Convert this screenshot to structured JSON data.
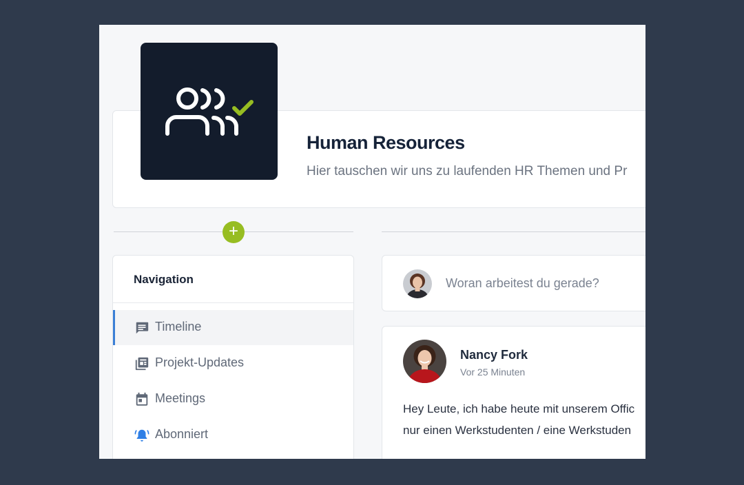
{
  "group": {
    "title": "Human Resources",
    "description": "Hier tauschen wir uns zu laufenden HR Themen und Pr",
    "logo_icon": "people-check-icon",
    "logo_bg": "#131c2c",
    "logo_accent": "#97bd22"
  },
  "add_button": {
    "label": "+",
    "icon": "plus-icon",
    "color": "#97bd22"
  },
  "navigation": {
    "title": "Navigation",
    "items": [
      {
        "label": "Timeline",
        "icon": "comment-icon",
        "active": true
      },
      {
        "label": "Projekt-Updates",
        "icon": "news-icon",
        "active": false
      },
      {
        "label": "Meetings",
        "icon": "calendar-icon",
        "active": false
      },
      {
        "label": "Abonniert",
        "icon": "bell-icon",
        "active": false
      }
    ],
    "active_color": "#3a7fd6"
  },
  "composer": {
    "placeholder": "Woran arbeitest du gerade?",
    "avatar": "user-avatar"
  },
  "post": {
    "author": "Nancy Fork",
    "time": "Vor 25 Minuten",
    "body_lines": [
      "Hey Leute, ich habe heute mit unserem Offic",
      "nur einen Werkstudenten / eine Werkstuden"
    ],
    "avatar": "author-avatar"
  }
}
